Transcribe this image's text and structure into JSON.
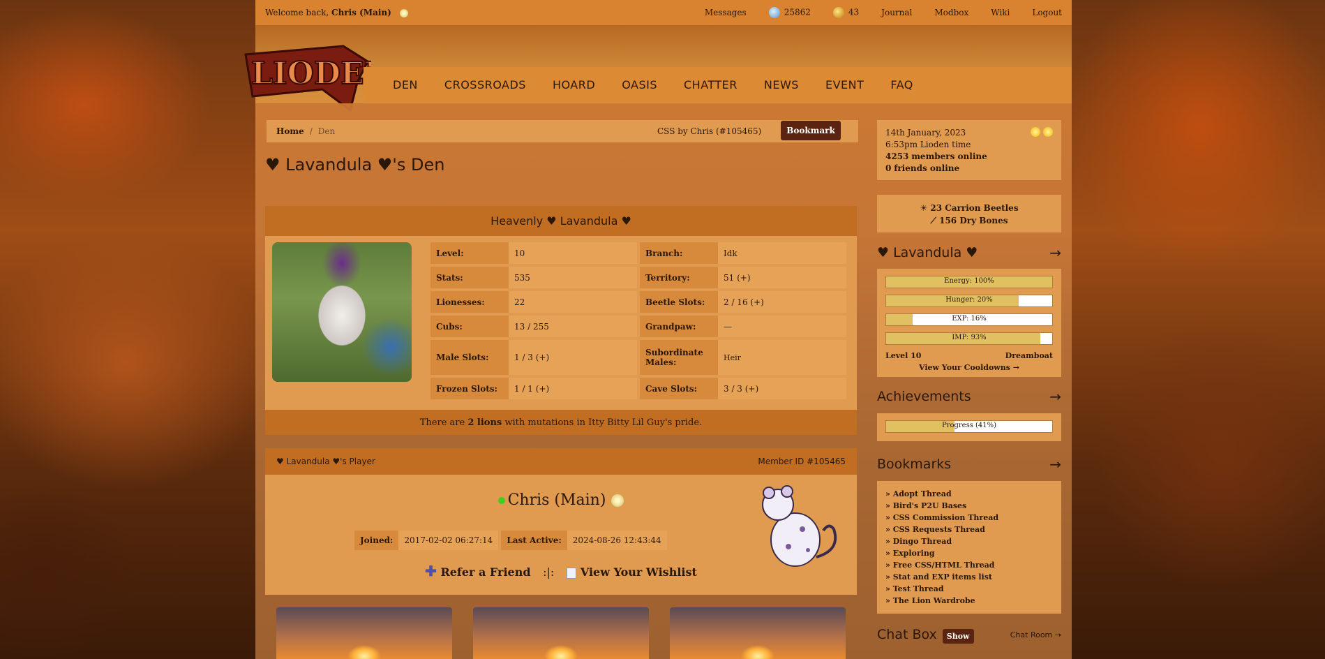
{
  "topbar": {
    "welcome_prefix": "Welcome back,",
    "welcome_user": "Chris (Main)",
    "links": [
      "Messages",
      "25862",
      "43",
      "Journal",
      "Modbox",
      "Wiki",
      "Logout"
    ]
  },
  "nav": [
    "DEN",
    "CROSSROADS",
    "HOARD",
    "OASIS",
    "CHATTER",
    "NEWS",
    "EVENT",
    "FAQ"
  ],
  "breadcrumb": {
    "home": "Home",
    "sep": "/",
    "current": "Den",
    "css_credit": "CSS by Chris (#105465)",
    "bookmark": "Bookmark"
  },
  "den": {
    "title": "♥ Lavandula ♥'s Den",
    "lion_name": "Heavenly ♥ Lavandula ♥",
    "stats": [
      {
        "k": "Level:",
        "v": "10",
        "k2": "Branch:",
        "v2": "Idk"
      },
      {
        "k": "Stats:",
        "v": "535",
        "k2": "Territory:",
        "v2": "51 (+)"
      },
      {
        "k": "Lionesses:",
        "v": "22",
        "k2": "Beetle Slots:",
        "v2": "2 / 16 (+)"
      },
      {
        "k": "Cubs:",
        "v": "13 / 255",
        "k2": "Grandpaw:",
        "v2": "—"
      },
      {
        "k": "Male Slots:",
        "v": "1 / 3 (+)",
        "k2": "Subordinate Males:",
        "v2": "Heir"
      },
      {
        "k": "Frozen Slots:",
        "v": "1 / 1 (+)",
        "k2": "Cave Slots:",
        "v2": "3 / 3 (+)"
      }
    ],
    "mutation_prefix": "There are",
    "mutation_count": "2 lions",
    "mutation_suffix": "with mutations in Itty Bitty Lil Guy's pride."
  },
  "player": {
    "header_left": "♥ Lavandula ♥'s Player",
    "header_right": "Member ID #105465",
    "name": "Chris (Main)",
    "joined_label": "Joined:",
    "joined": "2017-02-02 06:27:14",
    "active_label": "Last Active:",
    "active": "2024-08-26 12:43:44",
    "refer": "Refer a Friend",
    "pipe": ":|:",
    "wishlist": "View Your Wishlist"
  },
  "sidebar": {
    "date": "14th January, 2023",
    "time": "6:53pm Lioden time",
    "members_count": "4253",
    "members_label": "members online",
    "friends_count": "0",
    "friends_label": "friends online",
    "beetles": "23 Carrion Beetles",
    "bones": "156 Dry Bones",
    "lion_title": "♥ Lavandula ♥",
    "bars": [
      {
        "label": "Energy: 100%",
        "pct": 100
      },
      {
        "label": "Hunger: 20%",
        "pct": 80
      },
      {
        "label": "EXP: 16%",
        "pct": 16
      },
      {
        "label": "IMP: 93%",
        "pct": 93
      }
    ],
    "level": "Level 10",
    "rank": "Dreamboat",
    "cooldowns": "View Your Cooldowns →",
    "achievements_title": "Achievements",
    "progress_label": "Progress (41%)",
    "progress_pct": 41,
    "bookmarks_title": "Bookmarks",
    "bookmarks": [
      "» Adopt Thread",
      "» Bird's P2U Bases",
      "» CSS Commission Thread",
      "» CSS Requests Thread",
      "» Dingo Thread",
      "» Exploring",
      "» Free CSS/HTML Thread",
      "» Stat and EXP items list",
      "» Test Thread",
      "» The Lion Wardrobe"
    ],
    "arrow": "→",
    "chat_title": "Chat Box",
    "chat_show": "Show",
    "chat_room": "Chat Room →"
  }
}
